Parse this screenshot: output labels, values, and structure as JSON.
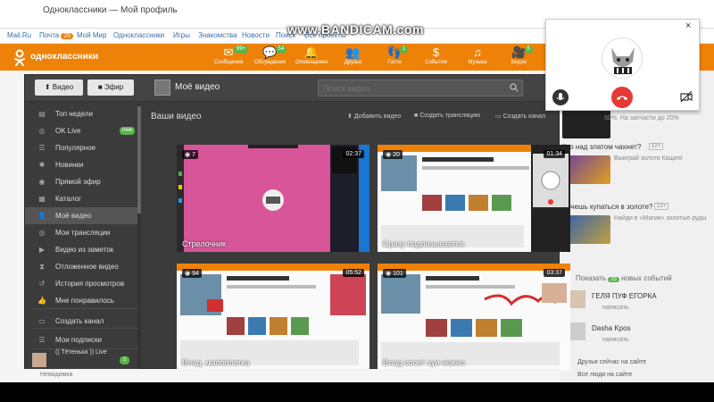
{
  "browser": {
    "tab_text": "Одноклассники — Мой профиль"
  },
  "watermark": "www.BANDICAM.com",
  "portal_nav": {
    "items": [
      {
        "label": "Mail.Ru"
      },
      {
        "label": "Почта",
        "badge": "25"
      },
      {
        "label": "Мой Мир"
      },
      {
        "label": "Одноклассники"
      },
      {
        "label": "Игры"
      },
      {
        "label": "Знакомства"
      },
      {
        "label": "Новости"
      },
      {
        "label": "Поиск"
      },
      {
        "label": "Все проекты"
      }
    ]
  },
  "header": {
    "logo_text": "одноклассники",
    "nav": [
      {
        "label": "Сообщения",
        "badge": "99+",
        "icon": "envelope-icon"
      },
      {
        "label": "Обсуждения",
        "badge": "54",
        "icon": "chat-icon"
      },
      {
        "label": "Оповещения",
        "badge": "",
        "icon": "bell-icon"
      },
      {
        "label": "Друзья",
        "badge": "",
        "icon": "friends-icon"
      },
      {
        "label": "Гости",
        "badge": "1",
        "icon": "guests-icon"
      },
      {
        "label": "События",
        "badge": "",
        "icon": "events-icon"
      },
      {
        "label": "Музыка",
        "badge": "",
        "icon": "music-icon"
      },
      {
        "label": "Видео",
        "badge": "5",
        "icon": "video-icon"
      }
    ]
  },
  "modal": {
    "video_button": "Видео",
    "live_button": "Эфир",
    "title": "Моё видео",
    "search_placeholder": "Поиск видео",
    "sidebar": [
      {
        "label": "Топ недели",
        "icon": "top-icon"
      },
      {
        "label": "OK Live",
        "icon": "live-icon",
        "badge": "new"
      },
      {
        "label": "Популярное",
        "icon": "popular-icon"
      },
      {
        "label": "Новинки",
        "icon": "new-icon"
      },
      {
        "label": "Прямой эфир",
        "icon": "broadcast-icon"
      },
      {
        "label": "Каталог",
        "icon": "catalog-icon"
      },
      {
        "label": "Моё видео",
        "icon": "my-video-icon",
        "active": true
      },
      {
        "label": "Мои трансляции",
        "icon": "my-broadcasts-icon"
      },
      {
        "label": "Видео из заметок",
        "icon": "notes-video-icon"
      },
      {
        "label": "Отложенное видео",
        "icon": "deferred-icon"
      },
      {
        "label": "История просмотров",
        "icon": "history-icon"
      },
      {
        "label": "Мне понравилось",
        "icon": "like-icon"
      },
      {
        "label": "Создать канал",
        "icon": "create-channel-icon"
      },
      {
        "label": "Мои подписки",
        "icon": "subscriptions-icon"
      }
    ],
    "subscription": {
      "name": "(( Тётенька )) Live",
      "count": "2"
    },
    "main": {
      "heading": "Ваши видео",
      "actions": [
        {
          "label": "Добавить видео",
          "icon": "upload-icon"
        },
        {
          "label": "Создать трансляцию",
          "icon": "camera-icon"
        },
        {
          "label": "Создать канал",
          "icon": "channel-icon"
        }
      ],
      "videos": [
        {
          "title": "Стрелочник",
          "views": "7",
          "duration": "02:37"
        },
        {
          "title": "Сразу подлизывается",
          "views": "20",
          "duration": "01:34"
        },
        {
          "title": "Влад, мапоплетка",
          "views": "94",
          "duration": "05:52"
        },
        {
          "title": "Влад сосет хуи нежно",
          "views": "101",
          "duration": "03:37"
        }
      ]
    }
  },
  "right_column": {
    "items": [
      {
        "title": "50%. На запчасти до 20%",
        "sub": ""
      },
      {
        "title": "Кто над златом чахнет?",
        "sub": "Выиграй золото Кащея!",
        "badge": "12+"
      },
      {
        "title": "Хочешь купаться в золоте?",
        "sub": "Найди в «Магии» золотые руды",
        "badge": "12+"
      },
      {
        "title": "Показать",
        "badge": "25",
        "suffix": "новых событий"
      }
    ],
    "friends": [
      {
        "name": "ГЕЛЯ ПУФ ЕГОРКА",
        "action": "написать"
      },
      {
        "name": "Dasha Kpos",
        "action": "написать"
      }
    ],
    "links": [
      "Друзья сейчас на сайте",
      "Все люди на сайте"
    ]
  },
  "call": {
    "close": "×"
  },
  "bottom": {
    "text": "Невидимка"
  },
  "colors": {
    "ok_orange": "#ee8208",
    "badge_green": "#5ab44a",
    "hangup_red": "#e53935"
  }
}
